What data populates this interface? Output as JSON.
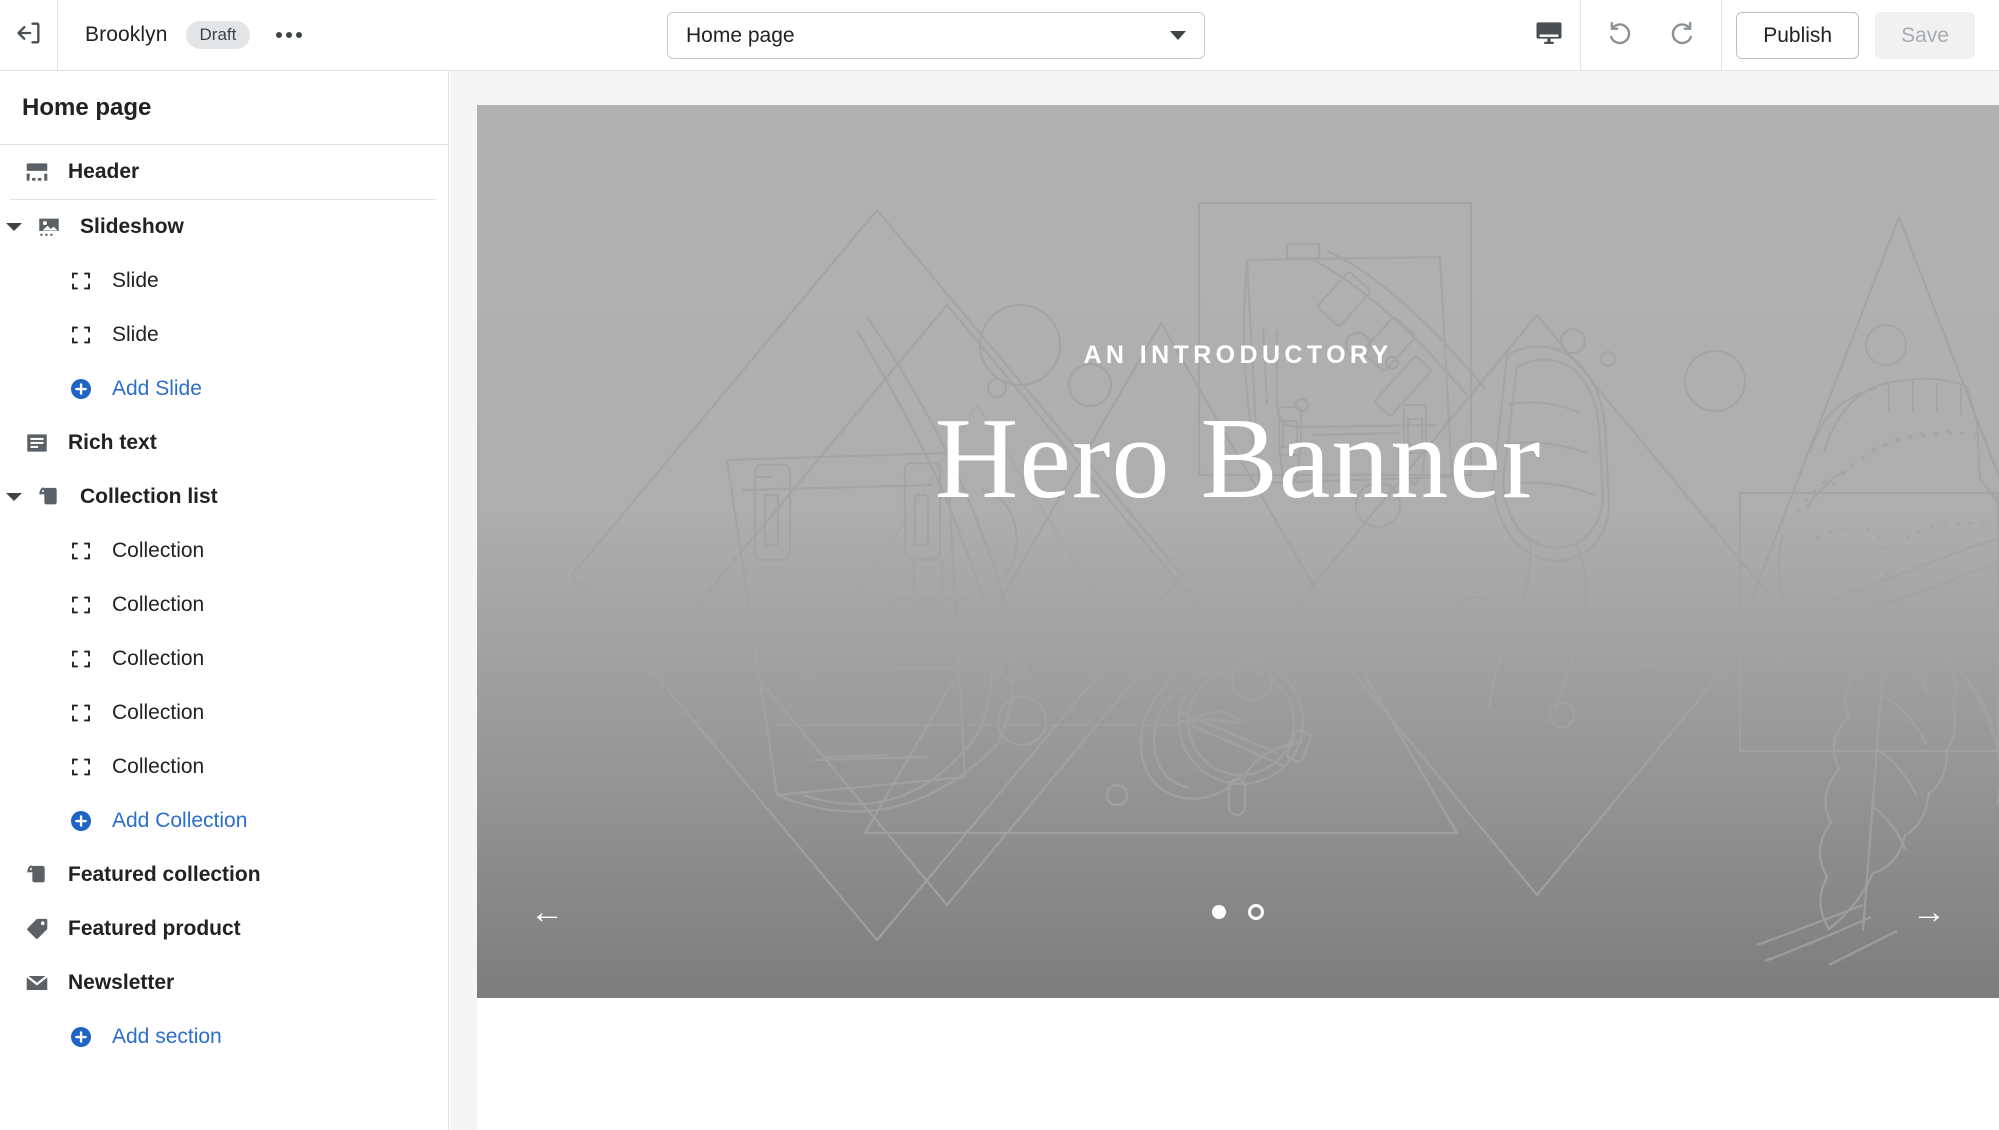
{
  "topbar": {
    "exit_icon": "exit-arrow-icon",
    "store_name": "Brooklyn",
    "status_badge": "Draft",
    "more_actions": "•••",
    "page_selector": {
      "value": "Home page",
      "caret_icon": "chevron-down-icon"
    },
    "device_preview_icon": "desktop-monitor-icon",
    "undo_icon": "undo-arrow-icon",
    "redo_icon": "redo-arrow-icon",
    "publish_label": "Publish",
    "save_label": "Save"
  },
  "sidebar": {
    "title": "Home page",
    "sections": [
      {
        "label": "Header",
        "icon": "header-layout-icon",
        "type": "section",
        "expandable": false
      },
      {
        "label": "Slideshow",
        "icon": "image-placeholder-icon",
        "type": "section",
        "expandable": true
      },
      {
        "label": "Slide",
        "icon": "block-brackets-icon",
        "type": "child"
      },
      {
        "label": "Slide",
        "icon": "block-brackets-icon",
        "type": "child"
      },
      {
        "label": "Add Slide",
        "icon": "plus-circle-icon",
        "type": "add"
      },
      {
        "label": "Rich text",
        "icon": "rich-text-icon",
        "type": "section",
        "expandable": false
      },
      {
        "label": "Collection list",
        "icon": "collection-tag-icon",
        "type": "section",
        "expandable": true
      },
      {
        "label": "Collection",
        "icon": "block-brackets-icon",
        "type": "child"
      },
      {
        "label": "Collection",
        "icon": "block-brackets-icon",
        "type": "child"
      },
      {
        "label": "Collection",
        "icon": "block-brackets-icon",
        "type": "child"
      },
      {
        "label": "Collection",
        "icon": "block-brackets-icon",
        "type": "child"
      },
      {
        "label": "Collection",
        "icon": "block-brackets-icon",
        "type": "child"
      },
      {
        "label": "Add Collection",
        "icon": "plus-circle-icon",
        "type": "add"
      },
      {
        "label": "Featured collection",
        "icon": "collection-tag-icon",
        "type": "section",
        "expandable": false
      },
      {
        "label": "Featured product",
        "icon": "product-tag-icon",
        "type": "section",
        "expandable": false
      },
      {
        "label": "Newsletter",
        "icon": "envelope-icon",
        "type": "section",
        "expandable": false
      },
      {
        "label": "Add section",
        "icon": "plus-circle-icon",
        "type": "add-section"
      }
    ]
  },
  "preview": {
    "hero": {
      "kicker": "AN INTRODUCTORY",
      "title": "Hero Banner",
      "prev_arrow": "←",
      "next_arrow": "→",
      "dots": [
        {
          "state": "active"
        },
        {
          "state": "inactive"
        }
      ]
    }
  },
  "colors": {
    "accent_blue": "#2c6ecb",
    "text_dark": "#202223",
    "border": "#e1e3e5",
    "hero_top": "#b1b1b1",
    "hero_bottom": "#7d7d7d",
    "badge_bg": "#e4e5e7",
    "canvas_bg": "#f5f5f5"
  }
}
